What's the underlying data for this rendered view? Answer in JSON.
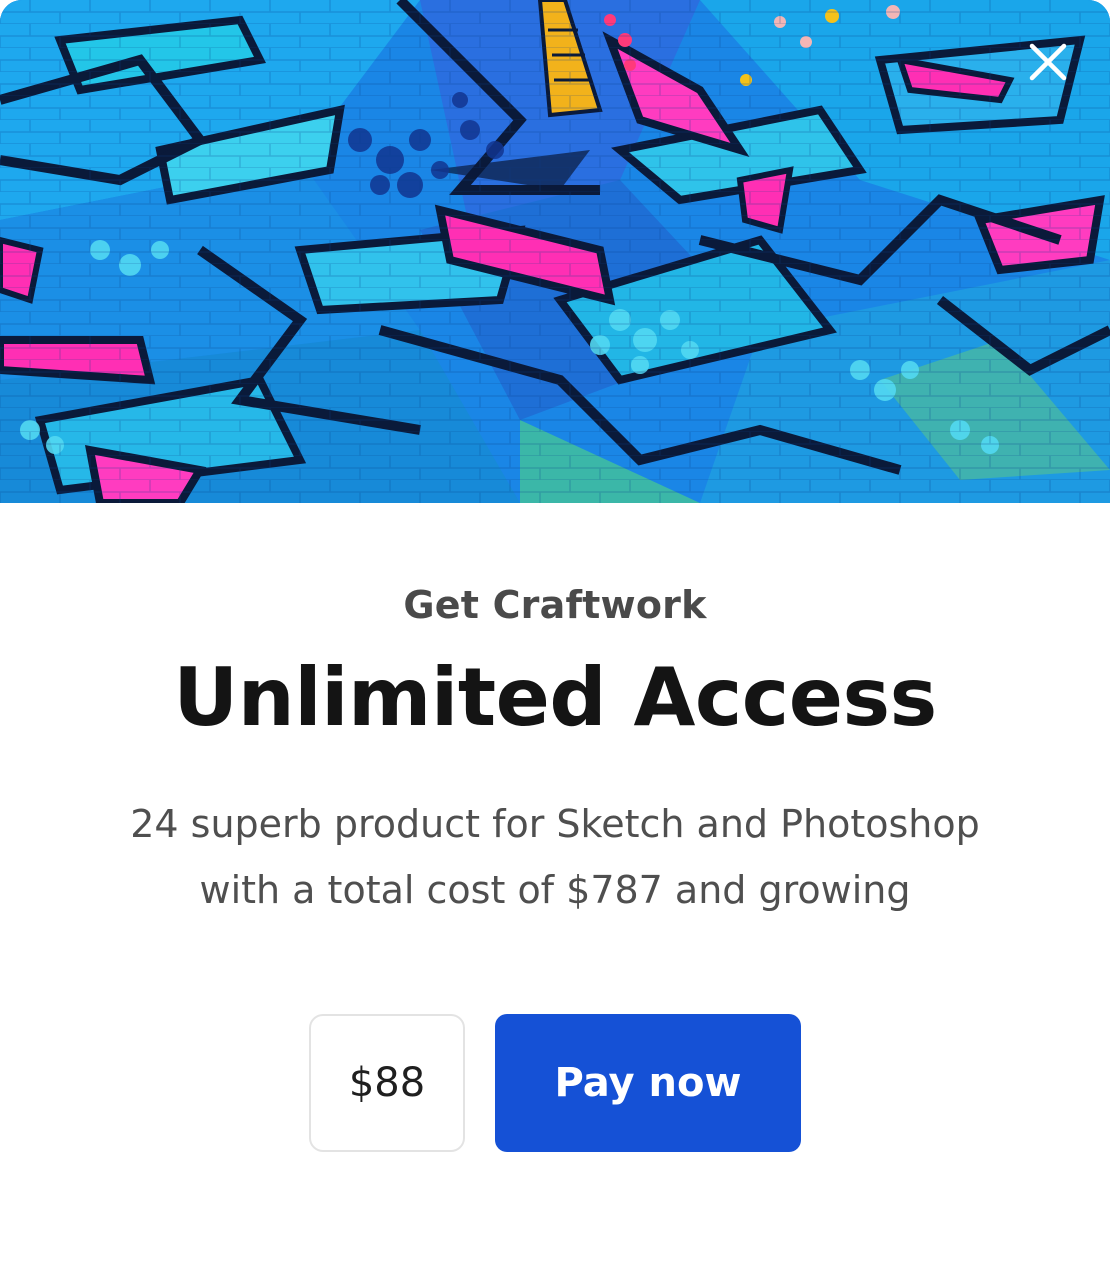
{
  "hero": {
    "image_name": "graffiti-wall-image",
    "close_icon": "close-icon"
  },
  "content": {
    "eyebrow": "Get Craftwork",
    "headline": "Unlimited Access",
    "description_line1": "24 superb product for Sketch and Photoshop",
    "description_line2": "with a total cost of $787 and growing"
  },
  "actions": {
    "price": "$88",
    "pay_label": "Pay now"
  },
  "colors": {
    "accent": "#1551d6",
    "eyebrow_text": "#4a4a4a",
    "headline_text": "#141414",
    "body_text": "#4f4f4f"
  }
}
